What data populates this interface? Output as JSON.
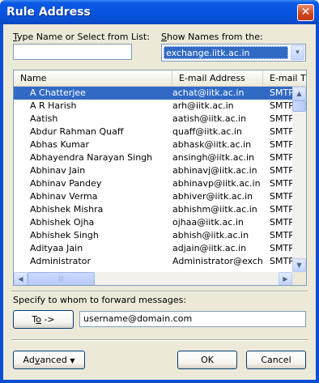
{
  "window": {
    "title": "Rule Address",
    "close_glyph": "✕"
  },
  "search": {
    "label_u": "T",
    "label_rest": "ype Name or Select from List:",
    "value": ""
  },
  "address_book": {
    "label_u": "S",
    "label_rest": "how Names from the:",
    "selected": "exchange.iitk.ac.in",
    "dropdown_glyph": "▾"
  },
  "list": {
    "columns": [
      "Name",
      "E-mail Address",
      "E-mail T"
    ],
    "rows": [
      {
        "name": "A Chatterjee",
        "email": "achat@iitk.ac.in",
        "type": "SMTP"
      },
      {
        "name": "A R Harish",
        "email": "arh@iitk.ac.in",
        "type": "SMTP"
      },
      {
        "name": "Aatish",
        "email": "aatish@iitk.ac.in",
        "type": "SMTP"
      },
      {
        "name": "Abdur Rahman Quaff",
        "email": "quaff@iitk.ac.in",
        "type": "SMTP"
      },
      {
        "name": "Abhas Kumar",
        "email": "abhask@iitk.ac.in",
        "type": "SMTP"
      },
      {
        "name": "Abhayendra Narayan Singh",
        "email": "ansingh@iitk.ac.in",
        "type": "SMTP"
      },
      {
        "name": "Abhinav Jain",
        "email": "abhinavj@iitk.ac.in",
        "type": "SMTP"
      },
      {
        "name": "Abhinav Pandey",
        "email": "abhinavp@iitk.ac.in",
        "type": "SMTP"
      },
      {
        "name": "Abhinav Verma",
        "email": "abhiver@iitk.ac.in",
        "type": "SMTP"
      },
      {
        "name": "Abhishek Mishra",
        "email": "abhishm@iitk.ac.in",
        "type": "SMTP"
      },
      {
        "name": "Abhishek Ojha",
        "email": "ojhaa@iitk.ac.in",
        "type": "SMTP"
      },
      {
        "name": "Abhishek Singh",
        "email": "abhish@iitk.ac.in",
        "type": "SMTP"
      },
      {
        "name": "Adityaa Jain",
        "email": "adjain@iitk.ac.in",
        "type": "SMTP"
      },
      {
        "name": "Administrator",
        "email": "Administrator@excha...",
        "type": "SMTP"
      }
    ],
    "selected_index": 0,
    "scroll_up": "▲",
    "scroll_down": "▼",
    "scroll_left": "◀",
    "scroll_right": "▶",
    "thumb_grip": "|||"
  },
  "forward": {
    "label": "Specify to whom to forward messages:",
    "to_button_u": "o",
    "to_button_pre": "T",
    "to_button_post": " ->",
    "recipient": "username@domain.com"
  },
  "footer": {
    "advanced_pre": "Ad",
    "advanced_u": "v",
    "advanced_post": "anced",
    "advanced_arrow": "▼",
    "ok": "OK",
    "cancel": "Cancel"
  },
  "colors": {
    "selection": "#316ac5",
    "titlebar": "#0a58e4",
    "close": "#d0431b",
    "face": "#ece9d8"
  }
}
